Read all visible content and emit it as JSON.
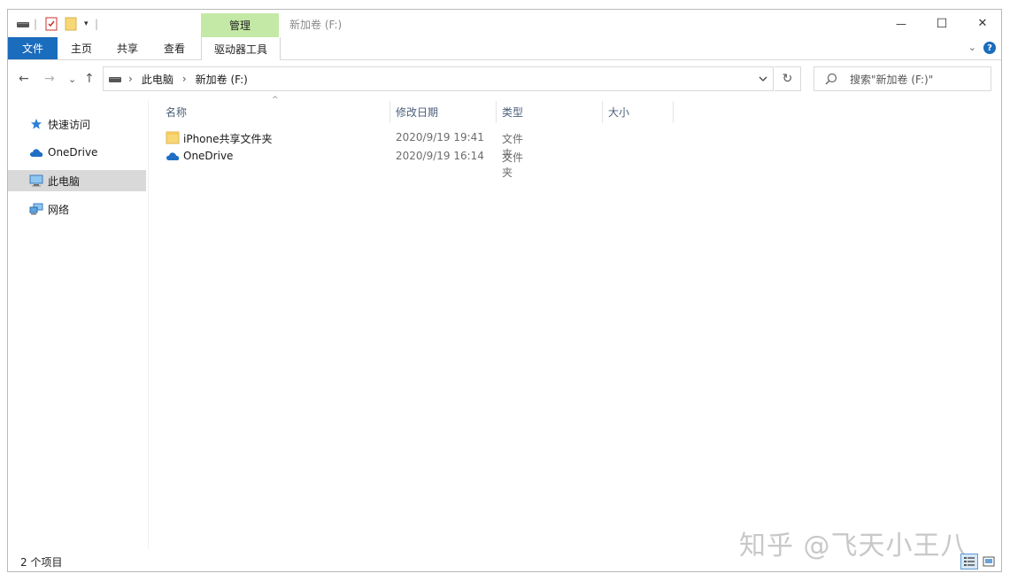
{
  "title_bar": {
    "contextual_tab": "管理",
    "window_title": "新加卷 (F:)",
    "minimize_glyph": "—",
    "maximize_glyph": "☐",
    "close_glyph": "✕"
  },
  "ribbon": {
    "tabs": [
      {
        "label": "文件",
        "active_style": "file"
      },
      {
        "label": "主页"
      },
      {
        "label": "共享"
      },
      {
        "label": "查看"
      },
      {
        "label": "驱动器工具"
      }
    ],
    "collapse_glyph": "⌄",
    "help_glyph": "?"
  },
  "address_bar": {
    "back_glyph": "←",
    "forward_glyph": "→",
    "recent_glyph": "⌄",
    "up_glyph": "↑",
    "breadcrumb": [
      "此电脑",
      "新加卷 (F:)"
    ],
    "separator": "›",
    "refresh_glyph": "↻",
    "search_placeholder": "搜索\"新加卷 (F:)\""
  },
  "navigation_pane": {
    "items": [
      {
        "label": "快速访问",
        "icon": "star-icon",
        "selected": false
      },
      {
        "label": "OneDrive",
        "icon": "cloud-icon",
        "selected": false
      },
      {
        "label": "此电脑",
        "icon": "computer-icon",
        "selected": true
      },
      {
        "label": "网络",
        "icon": "network-icon",
        "selected": false
      }
    ]
  },
  "file_list": {
    "sort_indicator": "^",
    "columns": [
      "名称",
      "修改日期",
      "类型",
      "大小"
    ],
    "rows": [
      {
        "name": "iPhone共享文件夹",
        "modified": "2020/9/19 19:41",
        "type": "文件夹",
        "icon": "folder-icon"
      },
      {
        "name": "OneDrive",
        "modified": "2020/9/19 16:14",
        "type": "文件夹",
        "icon": "onedrive-icon"
      }
    ]
  },
  "status_bar": {
    "item_count": "2 个项目"
  },
  "watermark": "知乎 @飞天小王八",
  "colors": {
    "accent": "#1a6cbd",
    "context_tab": "#c4e9a6",
    "selected_nav": "#d9d9d9",
    "folder": "#f8d775",
    "onedrive": "#1f6fc5"
  }
}
